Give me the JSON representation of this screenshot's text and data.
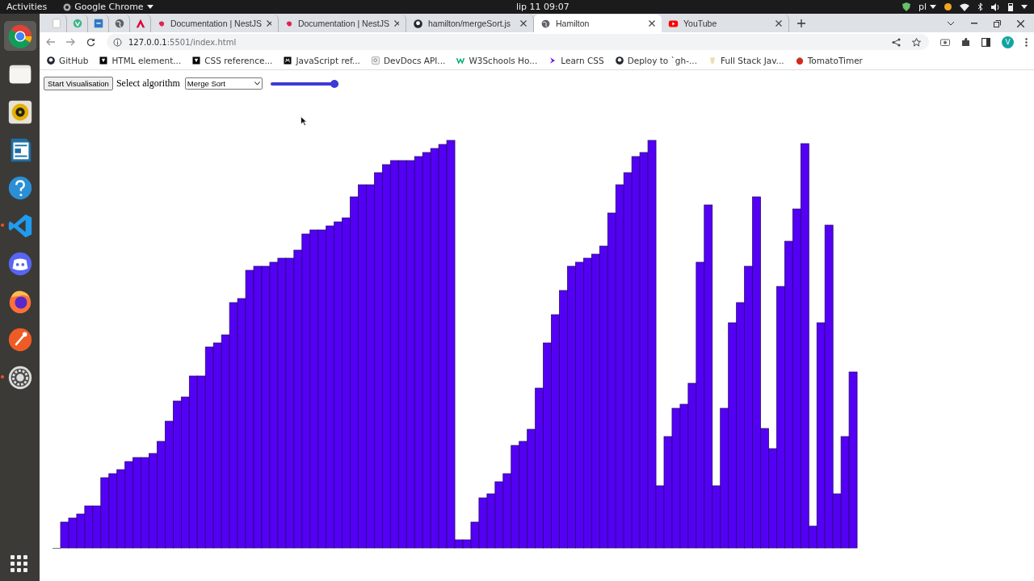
{
  "top_bar": {
    "activities": "Activities",
    "app_menu": "Google Chrome",
    "clock": "lip 11  09:07",
    "keyboard_layout": "pl"
  },
  "dock": [
    {
      "kind": "chrome",
      "selected": true,
      "running": false
    },
    {
      "kind": "files",
      "selected": false,
      "running": false
    },
    {
      "kind": "rhythmbox",
      "selected": false,
      "running": false
    },
    {
      "kind": "writer",
      "selected": false,
      "running": false
    },
    {
      "kind": "help",
      "selected": false,
      "running": false
    },
    {
      "kind": "vscode",
      "selected": false,
      "running": true
    },
    {
      "kind": "discord",
      "selected": false,
      "running": false
    },
    {
      "kind": "firefox",
      "selected": false,
      "running": false
    },
    {
      "kind": "postman",
      "selected": false,
      "running": false
    },
    {
      "kind": "settings",
      "selected": false,
      "running": true
    }
  ],
  "tabs": [
    {
      "kind": "blank",
      "selected": false
    },
    {
      "kind": "vue",
      "selected": false
    },
    {
      "kind": "ts",
      "selected": false
    },
    {
      "kind": "globe",
      "selected": false
    },
    {
      "kind": "angular",
      "selected": false
    },
    {
      "kind": "nest",
      "title": "Documentation | NestJS",
      "selected": false
    },
    {
      "kind": "nest",
      "title": "Documentation | NestJS",
      "selected": false
    },
    {
      "kind": "github",
      "title": "hamilton/mergeSort.js",
      "selected": false
    },
    {
      "kind": "globe",
      "title": "Hamilton",
      "selected": true
    },
    {
      "kind": "youtube",
      "title": "YouTube",
      "selected": false
    }
  ],
  "address_bar": {
    "host": "127.0.0.1",
    "path": ":5501/index.html"
  },
  "profile": {
    "initial": "V"
  },
  "bookmarks": [
    {
      "kind": "github",
      "label": "GitHub"
    },
    {
      "kind": "mdn",
      "label": "HTML element..."
    },
    {
      "kind": "mdn",
      "label": "CSS reference..."
    },
    {
      "kind": "mdnm",
      "label": "JavaScript ref..."
    },
    {
      "kind": "devdocs",
      "label": "DevDocs API..."
    },
    {
      "kind": "w3",
      "label": "W3Schools Ho..."
    },
    {
      "kind": "learncss",
      "label": "Learn CSS"
    },
    {
      "kind": "github",
      "label": "Deploy to `gh-..."
    },
    {
      "kind": "cup",
      "label": "Full Stack Jav..."
    },
    {
      "kind": "tomato",
      "label": "TomatoTimer"
    }
  ],
  "page": {
    "start_button": "Start Visualisation",
    "algorithm_label": "Select algorithm",
    "algorithm_select": {
      "value": "Merge Sort"
    },
    "speed_slider": {
      "level": 1
    }
  }
}
